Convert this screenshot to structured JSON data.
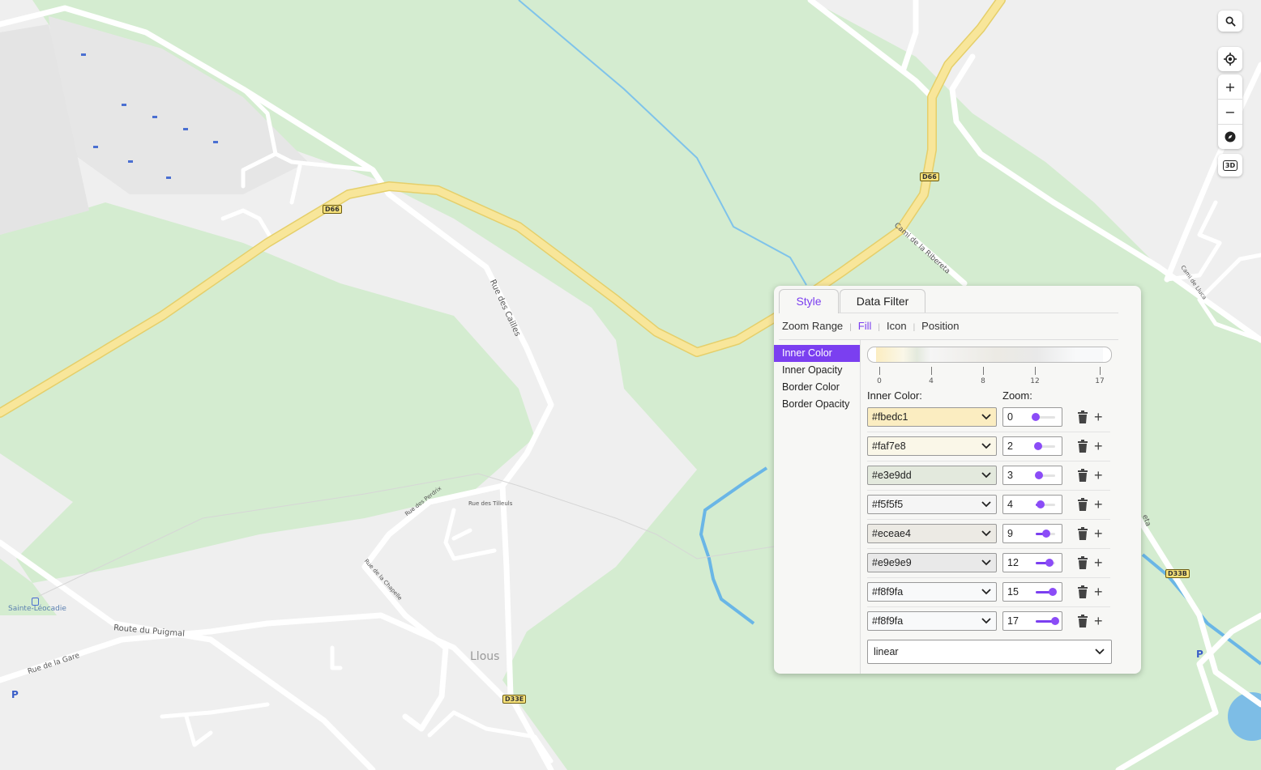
{
  "map": {
    "labels": {
      "rue_des_cailles": "Rue des Cailles",
      "cami_ribereta": "Cami de la Ribereta",
      "rue_des_perdrix": "Rue des Perdrix",
      "rue_des_tilleuls": "Rue des Tilleuls",
      "rue_de_la_chapelle": "Rue de la Chapelle",
      "route_puigmal": "Route du Puigmal",
      "rue_de_la_gare": "Rue de la Gare",
      "sainte_leocadie": "Sainte-Léocadie",
      "llous": "Llous",
      "cami_lluca": "Cami de Lluca",
      "retta_fragment": "eta",
      "parking_left": "P",
      "parking_right": "P"
    },
    "shields": {
      "d66_left": "D66",
      "d66_right": "D66",
      "d33e": "D33E",
      "d33b": "D33B"
    }
  },
  "controls": {
    "search_icon": "search-icon",
    "locate_icon": "locate-icon",
    "zoom_in": "+",
    "zoom_out": "−",
    "compass_icon": "compass-icon",
    "three_d": "3D"
  },
  "panel": {
    "tabs": [
      "Style",
      "Data Filter"
    ],
    "active_tab": "Style",
    "subtabs": [
      "Zoom Range",
      "Fill",
      "Icon",
      "Position"
    ],
    "active_subtab": "Fill",
    "properties": [
      "Inner Color",
      "Inner Opacity",
      "Border Color",
      "Border Opacity"
    ],
    "active_property": "Inner Color",
    "zoom_ticks": [
      "0",
      "4",
      "8",
      "12",
      "17"
    ],
    "inner_color_label": "Inner Color:",
    "zoom_label": "Zoom:",
    "stops": [
      {
        "color": "#fbedc1",
        "zoom": "0",
        "pos": 0.0
      },
      {
        "color": "#faf7e8",
        "zoom": "2",
        "pos": 0.12
      },
      {
        "color": "#e3e9dd",
        "zoom": "3",
        "pos": 0.18
      },
      {
        "color": "#f5f5f5",
        "zoom": "4",
        "pos": 0.24
      },
      {
        "color": "#eceae4",
        "zoom": "9",
        "pos": 0.53
      },
      {
        "color": "#e9e9e9",
        "zoom": "12",
        "pos": 0.71
      },
      {
        "color": "#f8f9fa",
        "zoom": "15",
        "pos": 0.88
      },
      {
        "color": "#f8f9fa",
        "zoom": "17",
        "pos": 1.0
      }
    ],
    "interpolation": "linear",
    "accent": "#7b3ff0"
  }
}
